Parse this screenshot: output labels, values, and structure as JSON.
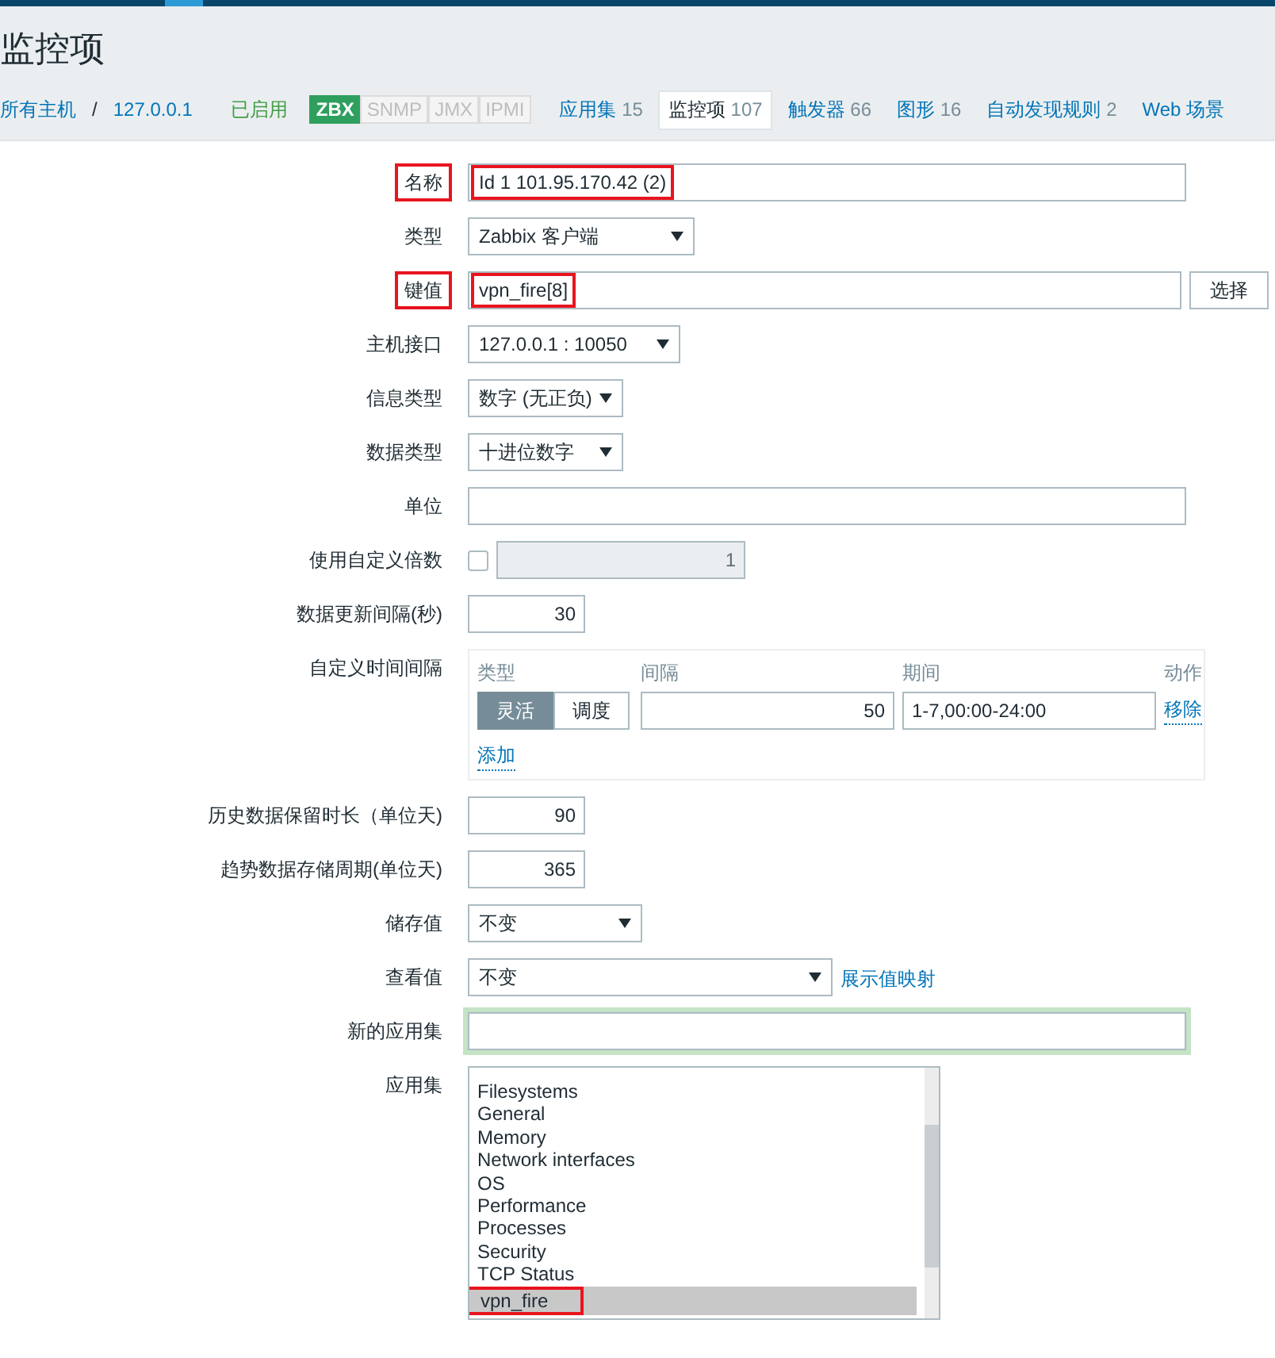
{
  "page_title": "监控项",
  "breadcrumbs": [
    {
      "label": "所有主机"
    },
    {
      "label": "127.0.0.1"
    }
  ],
  "breadcrumb_separator": "/",
  "status": "已启用",
  "protocols": [
    {
      "label": "ZBX",
      "on": true
    },
    {
      "label": "SNMP",
      "on": false
    },
    {
      "label": "JMX",
      "on": false
    },
    {
      "label": "IPMI",
      "on": false
    }
  ],
  "tabs": [
    {
      "label": "应用集",
      "count": "15",
      "selected": false
    },
    {
      "label": "监控项",
      "count": "107",
      "selected": true
    },
    {
      "label": "触发器",
      "count": "66",
      "selected": false
    },
    {
      "label": "图形",
      "count": "16",
      "selected": false
    },
    {
      "label": "自动发现规则",
      "count": "2",
      "selected": false
    },
    {
      "label": "Web 场景",
      "selected": false
    }
  ],
  "fields": [
    {
      "kind": "text",
      "label": "名称",
      "value": "Id 1 101.95.170.42 (2)",
      "highlighted": true
    },
    {
      "kind": "select",
      "label": "类型",
      "value": "Zabbix 客户端"
    },
    {
      "kind": "key",
      "label": "键值",
      "value": "vpn_fire[8]",
      "button": "选择",
      "highlighted": true
    },
    {
      "kind": "select",
      "label": "主机接口",
      "value": "127.0.0.1 : 10050"
    },
    {
      "kind": "select",
      "label": "信息类型",
      "value": "数字 (无正负)"
    },
    {
      "kind": "select",
      "label": "数据类型",
      "value": "十进位数字"
    },
    {
      "kind": "text",
      "label": "单位"
    },
    {
      "kind": "multiplier",
      "label": "使用自定义倍数",
      "checked": false,
      "value": "1"
    },
    {
      "kind": "number",
      "label": "数据更新间隔(秒)",
      "value": "30"
    },
    {
      "kind": "intervals",
      "label": "自定义时间间隔",
      "columns": [
        "类型",
        "间隔",
        "期间",
        "动作"
      ],
      "rows": [
        {
          "modes": [
            {
              "label": "灵活",
              "selected": true
            },
            {
              "label": "调度",
              "selected": false
            }
          ],
          "interval": "50",
          "period": "1-7,00:00-24:00",
          "action": "移除"
        }
      ],
      "add": "添加"
    },
    {
      "kind": "number",
      "label": "历史数据保留时长（单位天)",
      "value": "90"
    },
    {
      "kind": "number",
      "label": "趋势数据存储周期(单位天)",
      "value": "365"
    },
    {
      "kind": "select",
      "label": "储存值",
      "value": "不变"
    },
    {
      "kind": "select",
      "label": "查看值",
      "value": "不变",
      "link": "展示值映射"
    },
    {
      "kind": "focused",
      "label": "新的应用集"
    },
    {
      "kind": "listbox",
      "label": "应用集",
      "items": [
        {
          "label": "Filesystems",
          "selected": false
        },
        {
          "label": "General",
          "selected": false
        },
        {
          "label": "Memory",
          "selected": false
        },
        {
          "label": "Network interfaces",
          "selected": false
        },
        {
          "label": "OS",
          "selected": false
        },
        {
          "label": "Performance",
          "selected": false
        },
        {
          "label": "Processes",
          "selected": false
        },
        {
          "label": "Security",
          "selected": false
        },
        {
          "label": "TCP Status",
          "selected": false
        },
        {
          "label": "vpn_fire",
          "selected": true,
          "highlighted": true
        }
      ]
    }
  ]
}
